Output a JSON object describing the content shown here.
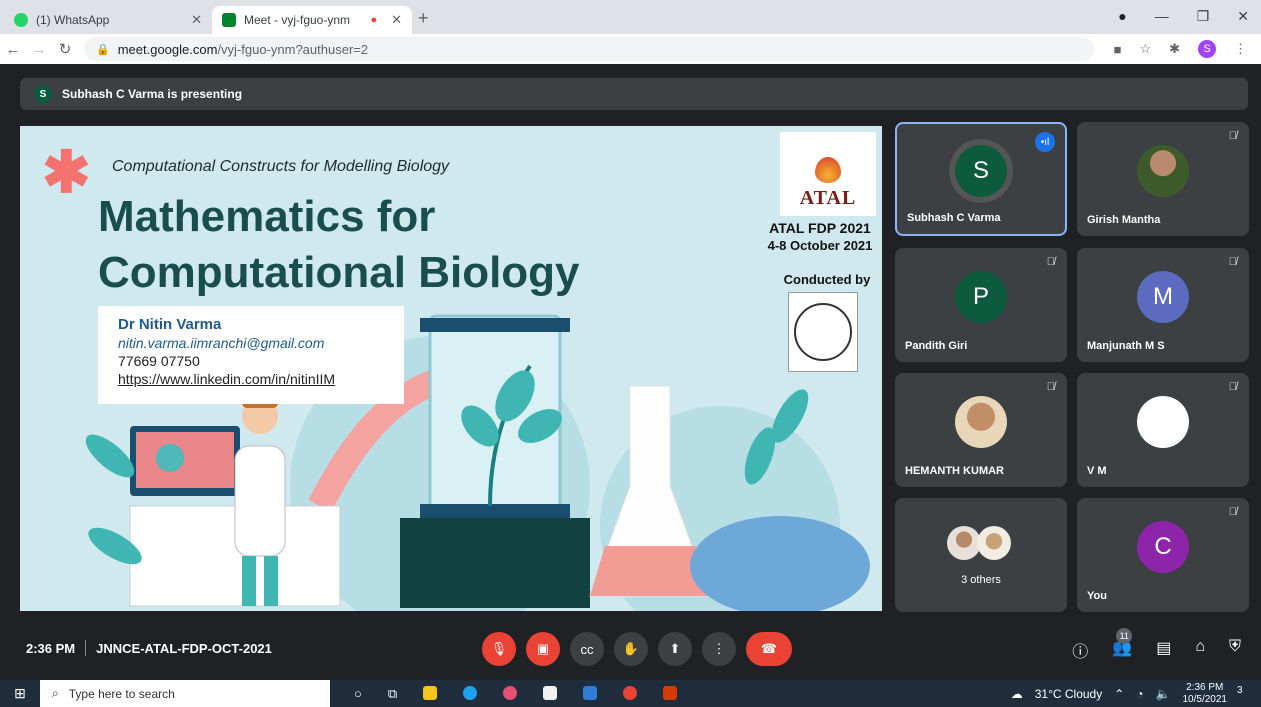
{
  "browser": {
    "tabs": [
      {
        "label": "(1) WhatsApp",
        "favicon_color": "#25d366"
      },
      {
        "label": "Meet - vyj-fguo-ynm",
        "favicon_color": "#00832d",
        "recording": true
      }
    ],
    "url_host": "meet.google.com",
    "url_path": "/vyj-fguo-ynm?authuser=2",
    "profile_initial": "S"
  },
  "meet": {
    "presenting_avatar": "S",
    "presenting_text": "Subhash C Varma is presenting",
    "meeting_time": "2:36 PM",
    "meeting_code": "JNNCE-ATAL-FDP-OCT-2021",
    "participant_count": "11"
  },
  "slide": {
    "subtitle": "Computational Constructs for Modelling Biology",
    "title_line1": "Mathematics for",
    "title_line2": "Computational Biology",
    "contact_name": "Dr Nitin Varma",
    "contact_email": "nitin.varma.iimranchi@gmail.com",
    "contact_phone": "77669 07750",
    "contact_link": "https://www.linkedin.com/in/nitinIIM",
    "logo_word": "ATAL",
    "fdp_line1": "ATAL FDP 2021",
    "fdp_line2": "4-8 October 2021",
    "conducted_by": "Conducted by"
  },
  "participants": [
    {
      "name": "Subhash C Varma",
      "initial": "S",
      "color": "#0d5b3e",
      "speaking": true
    },
    {
      "name": "Girish Mantha",
      "photo": true,
      "muted": true
    },
    {
      "name": "Pandith Giri",
      "initial": "P",
      "color": "#0d5b3e",
      "muted": true
    },
    {
      "name": "Manjunath M S",
      "initial": "M",
      "color": "#5c6bc0",
      "muted": true
    },
    {
      "name": "HEMANTH KUMAR",
      "photo": true,
      "muted": true
    },
    {
      "name": "V M",
      "initial": "",
      "color": "#ffffff",
      "muted": true
    },
    {
      "name": "3 others"
    },
    {
      "name": "You",
      "initial": "C",
      "color": "#8e24aa",
      "muted": true
    }
  ],
  "taskbar": {
    "search_placeholder": "Type here to search",
    "weather": "31°C  Cloudy",
    "time": "2:36 PM",
    "date": "10/5/2021",
    "notifications": "3"
  }
}
